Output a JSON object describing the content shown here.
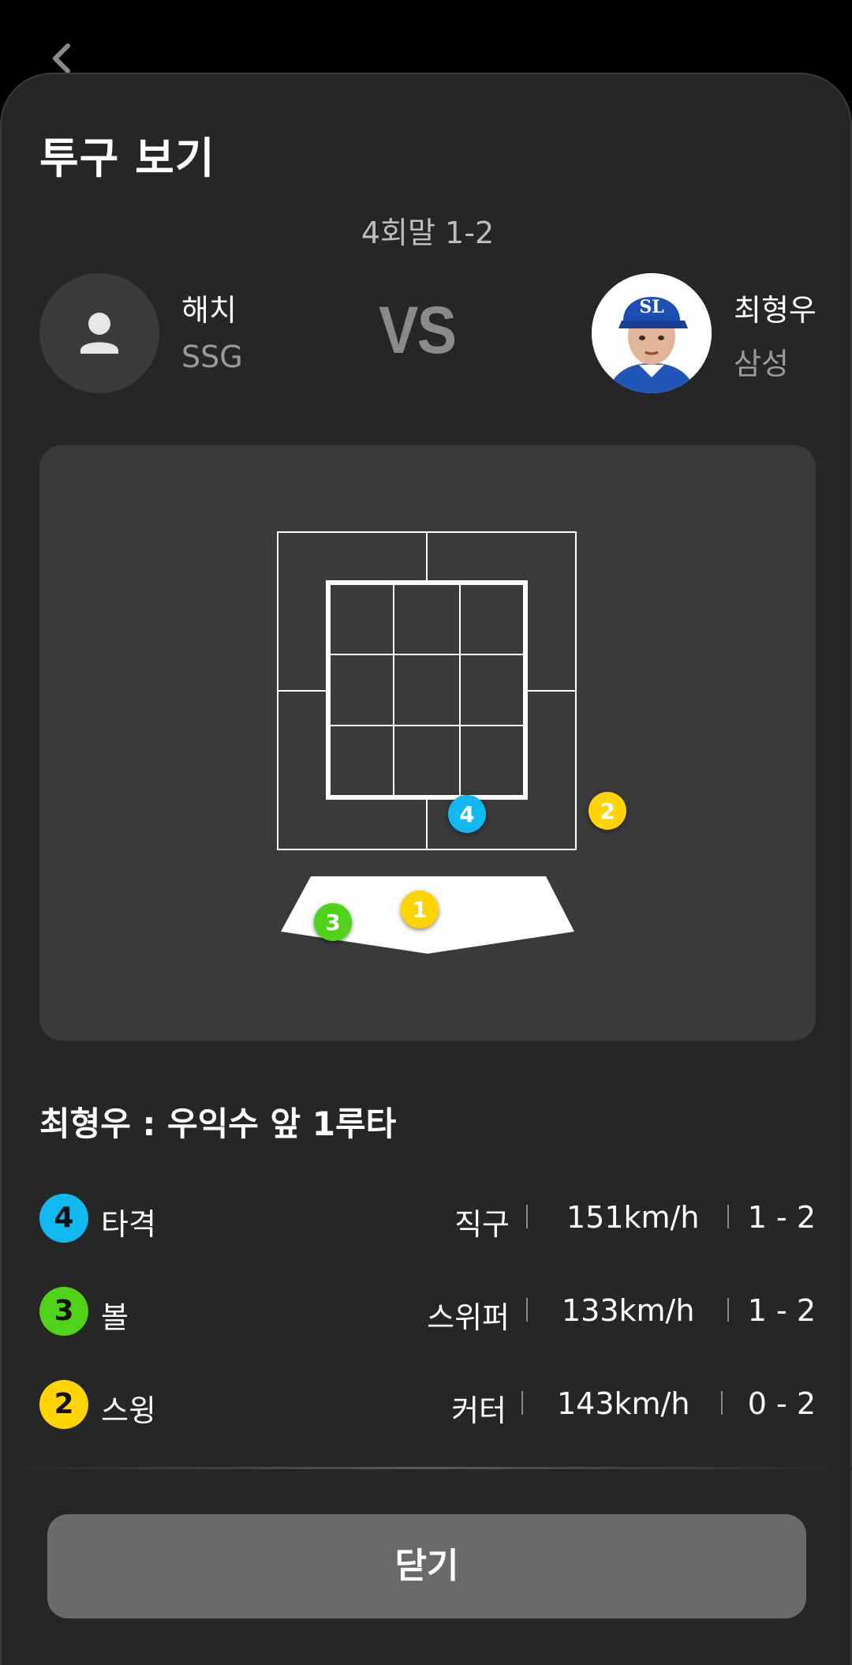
{
  "header": {
    "title": "투구 보기",
    "inning": "4회말 1-2"
  },
  "batter": {
    "name": "해치",
    "team": "SSG"
  },
  "versus_label": "VS",
  "pitcher": {
    "name": "최형우",
    "team": "삼성",
    "cap_logo": "SL"
  },
  "zone": {
    "markers": [
      {
        "number": "1",
        "color": "#FFD400"
      },
      {
        "number": "2",
        "color": "#FFD400"
      },
      {
        "number": "3",
        "color": "#4FD219"
      },
      {
        "number": "4",
        "color": "#12B8F0"
      }
    ]
  },
  "result_text": "최형우 : 우익수 앞 1루타",
  "pitches": [
    {
      "number": "4",
      "color": "#12B8F0",
      "label": "타격",
      "pitch_type": "직구",
      "speed": "151km/h",
      "count": "1 - 2"
    },
    {
      "number": "3",
      "color": "#4FD219",
      "label": "볼",
      "pitch_type": "스위퍼",
      "speed": "133km/h",
      "count": "1 - 2"
    },
    {
      "number": "2",
      "color": "#FFD400",
      "label": "스윙",
      "pitch_type": "커터",
      "speed": "143km/h",
      "count": "0 - 2"
    }
  ],
  "close_button": "닫기",
  "icons": {
    "back": "chevron-left-icon",
    "person": "person-icon"
  }
}
